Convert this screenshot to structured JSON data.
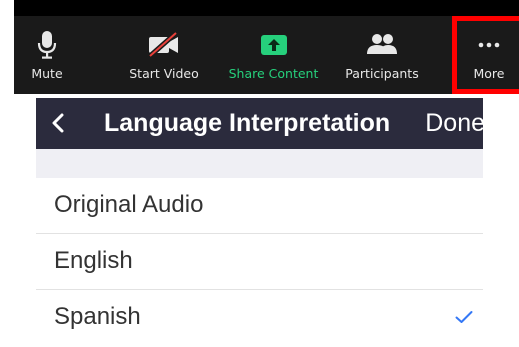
{
  "toolbar": {
    "items": [
      {
        "label": "Mute",
        "icon": "microphone-icon"
      },
      {
        "label": "Start Video",
        "icon": "video-off-icon"
      },
      {
        "label": "Share Content",
        "icon": "share-arrow-icon"
      },
      {
        "label": "Participants",
        "icon": "participants-icon"
      },
      {
        "label": "More",
        "icon": "more-dots-icon"
      }
    ],
    "colors": {
      "background": "#1a1a1a",
      "share_green": "#26d07c",
      "highlight": "#ff0000"
    }
  },
  "panel": {
    "title": "Language Interpretation",
    "done_label": "Done",
    "back_icon": "chevron-left-icon",
    "options": [
      {
        "label": "Original Audio",
        "selected": false
      },
      {
        "label": "English",
        "selected": false
      },
      {
        "label": "Spanish",
        "selected": true
      }
    ],
    "colors": {
      "nav_background": "#2b2b3d",
      "check": "#3478f6"
    }
  }
}
